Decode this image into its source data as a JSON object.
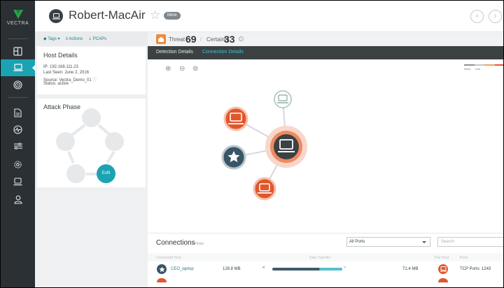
{
  "app": {
    "brand": "VECTRA"
  },
  "header": {
    "host_name": "Robert-MacAir",
    "more_label": "More",
    "back_glyph": "‹",
    "forward_glyph": "›"
  },
  "sidebar": {
    "items": [
      {
        "icon": "dashboard-icon"
      },
      {
        "icon": "host-icon",
        "active": true
      },
      {
        "icon": "fingerprint-icon"
      },
      {
        "icon": "report-icon"
      },
      {
        "icon": "activity-icon"
      },
      {
        "icon": "filter-icon"
      },
      {
        "icon": "settings-icon"
      },
      {
        "icon": "laptop-icon"
      },
      {
        "icon": "user-icon"
      }
    ]
  },
  "toolbar": {
    "tags_label": "Tags ▾",
    "actions_label": "Actions",
    "pcaps_label": "PCAPs"
  },
  "host_details": {
    "title": "Host Details",
    "ip": "IP: 192.168.111.23",
    "last_seen": "Last Seen: June 2, 2016",
    "source": "Source:  Vectra_Demo_01",
    "status": "Status: active"
  },
  "attack_phase": {
    "title": "Attack Phase",
    "active_phase": "Exfil"
  },
  "scores": {
    "threat_label": "Threat",
    "threat_value": "69",
    "certainty_label": "Certainty",
    "certainty_value": "33"
  },
  "tabs": {
    "detection": "Detection Details",
    "connection": "Connection Details"
  },
  "legend": {
    "none": "None",
    "low": "Low",
    "colors": [
      "#8c9297",
      "#c2c7ca",
      "#f0a463",
      "#e2562b"
    ]
  },
  "connections": {
    "title": "Connections",
    "count": "4 Hosts",
    "port_filter": "All Ports",
    "search_placeholder": "Search",
    "columns": {
      "connected_host": "Connected Host",
      "data_transfer": "Data Transfer",
      "this_host": "This Host",
      "ports": "Ports"
    },
    "rows": [
      {
        "host": "CEO_laptop",
        "sent": "128.8 MB",
        "received": "71.4 MB",
        "ports": "TCP Ports: 1243"
      }
    ]
  }
}
